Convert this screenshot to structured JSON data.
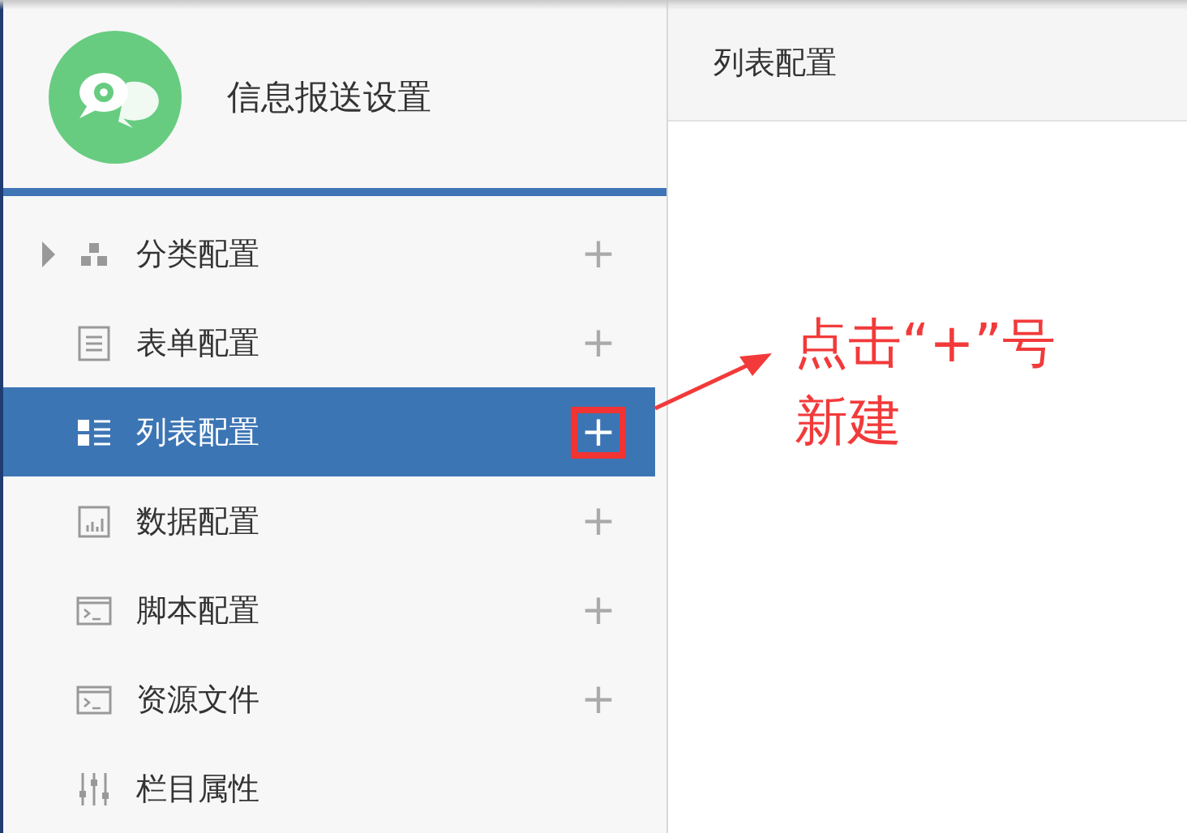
{
  "sidebar": {
    "title": "信息报送设置",
    "items": [
      {
        "label": "分类配置",
        "kind": "group",
        "expanded": false,
        "selected": false,
        "add": "+",
        "annotated": false
      },
      {
        "label": "表单配置",
        "kind": "item",
        "selected": false,
        "add": "+",
        "annotated": false
      },
      {
        "label": "列表配置",
        "kind": "item",
        "selected": true,
        "add": "+",
        "annotated": true
      },
      {
        "label": "数据配置",
        "kind": "item",
        "selected": false,
        "add": "+",
        "annotated": false
      },
      {
        "label": "脚本配置",
        "kind": "item",
        "selected": false,
        "add": "+",
        "annotated": false
      },
      {
        "label": "资源文件",
        "kind": "item",
        "selected": false,
        "add": "+",
        "annotated": false
      },
      {
        "label": "栏目属性",
        "kind": "item",
        "selected": false
      }
    ]
  },
  "panel": {
    "title": "列表配置"
  },
  "annotation": {
    "lines": [
      "点击“+”号",
      "新建"
    ]
  }
}
